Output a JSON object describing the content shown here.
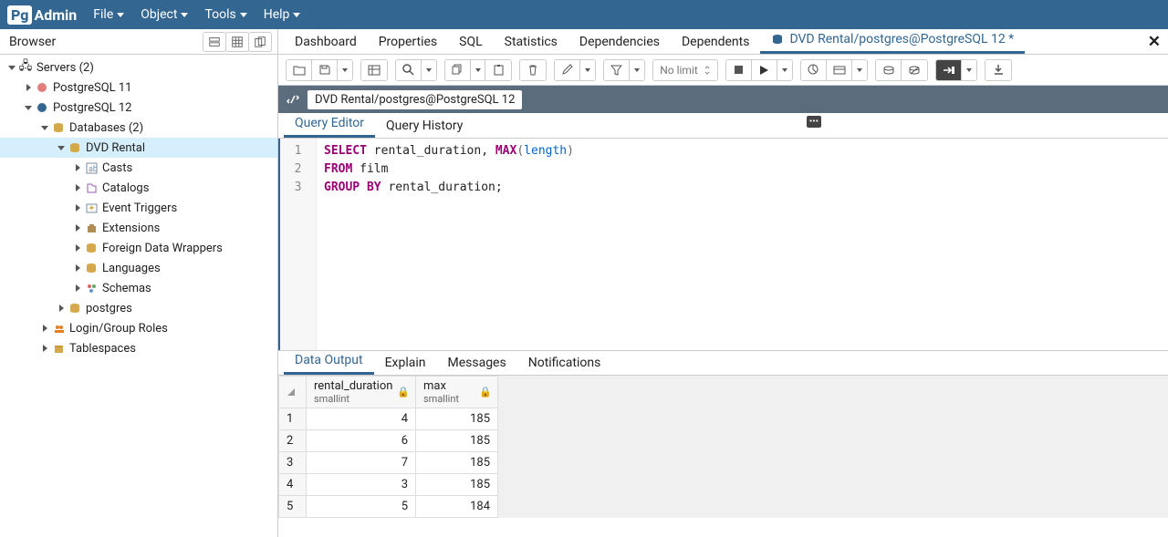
{
  "app": {
    "logo_prefix": "Pg",
    "logo_rest": "Admin"
  },
  "menubar": [
    "File",
    "Object",
    "Tools",
    "Help"
  ],
  "browser": {
    "title": "Browser",
    "tree": {
      "servers": "Servers (2)",
      "pg11": "PostgreSQL 11",
      "pg12": "PostgreSQL 12",
      "databases": "Databases (2)",
      "dvd": "DVD Rental",
      "casts": "Casts",
      "catalogs": "Catalogs",
      "evt": "Event Triggers",
      "ext": "Extensions",
      "fdw": "Foreign Data Wrappers",
      "lang": "Languages",
      "schemas": "Schemas",
      "postgres": "postgres",
      "roles": "Login/Group Roles",
      "ts": "Tablespaces"
    }
  },
  "main_tabs": {
    "dashboard": "Dashboard",
    "properties": "Properties",
    "sql": "SQL",
    "statistics": "Statistics",
    "dependencies": "Dependencies",
    "dependents": "Dependents",
    "query": "DVD Rental/postgres@PostgreSQL 12 *"
  },
  "toolbar": {
    "limit": "No limit"
  },
  "connection": {
    "label": "DVD Rental/postgres@PostgreSQL 12"
  },
  "query_tabs": {
    "editor": "Query Editor",
    "history": "Query History"
  },
  "scratch_label": "•••",
  "sql": {
    "lines": [
      "1",
      "2",
      "3"
    ],
    "l1_select": "SELECT",
    "l1_col": " rental_duration, ",
    "l1_max": "MAX",
    "l1_p1": "(",
    "l1_len": "length",
    "l1_p2": ")",
    "l2_from": "FROM",
    "l2_tbl": " film",
    "l3_group": "GROUP",
    "l3_by": "BY",
    "l3_col": " rental_duration;"
  },
  "output_tabs": {
    "data": "Data Output",
    "explain": "Explain",
    "messages": "Messages",
    "notif": "Notifications"
  },
  "columns": [
    {
      "name": "rental_duration",
      "type": "smallint"
    },
    {
      "name": "max",
      "type": "smallint"
    }
  ],
  "rows": [
    {
      "n": "1",
      "c1": "4",
      "c2": "185"
    },
    {
      "n": "2",
      "c1": "6",
      "c2": "185"
    },
    {
      "n": "3",
      "c1": "7",
      "c2": "185"
    },
    {
      "n": "4",
      "c1": "3",
      "c2": "185"
    },
    {
      "n": "5",
      "c1": "5",
      "c2": "184"
    }
  ]
}
